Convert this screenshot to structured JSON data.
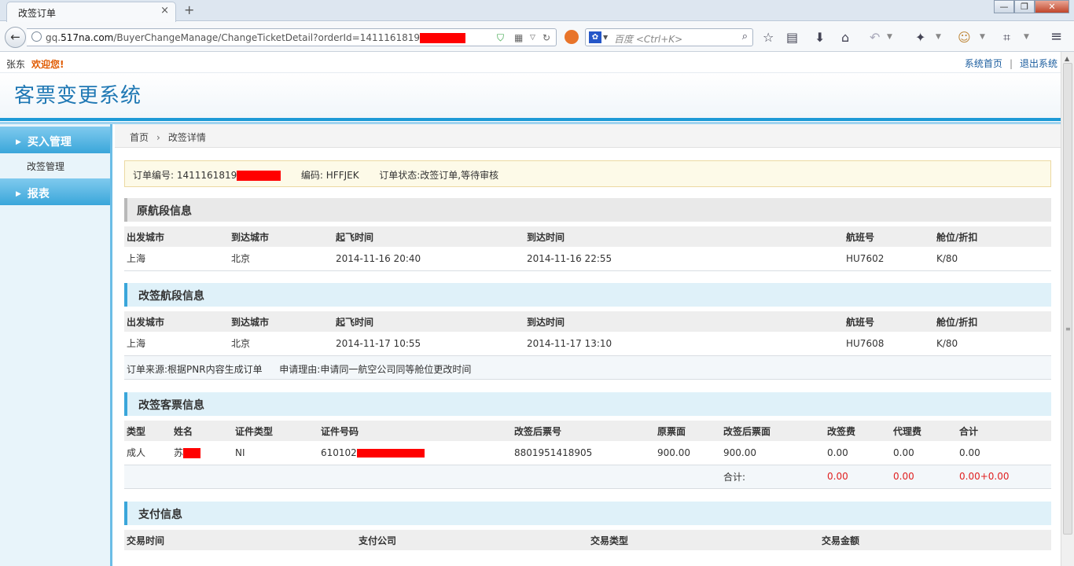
{
  "browser": {
    "tab_title": "改签订单",
    "tab_close": "×",
    "new_tab": "+",
    "url_prefix": "gq.",
    "url_domain": "517na.com",
    "url_path": "/BuyerChangeManage/ChangeTicketDetail?orderId=1411161819",
    "search_placeholder": "百度 <Ctrl+K>",
    "window_buttons": [
      "—",
      "❐",
      "✕"
    ]
  },
  "user": {
    "name": "张东",
    "welcome": "欢迎您!"
  },
  "top_links": [
    "系统首页",
    "退出系统"
  ],
  "system_title": "客票变更系统",
  "sidebar": {
    "groups": [
      {
        "label": "买入管理",
        "items": [
          "改签管理"
        ]
      },
      {
        "label": "报表",
        "items": []
      }
    ]
  },
  "breadcrumb": [
    "首页",
    "改签详情"
  ],
  "order": {
    "number_label": "订单编号:",
    "number": "1411161819",
    "code_label": "编码:",
    "code": "HFFJEK",
    "status_label": "订单状态:",
    "status": "改签订单,等待审核"
  },
  "flight_headers": [
    "出发城市",
    "到达城市",
    "起飞时间",
    "到达时间",
    "航班号",
    "舱位/折扣"
  ],
  "original_segment": {
    "title": "原航段信息",
    "rows": [
      [
        "上海",
        "北京",
        "2014-11-16 20:40",
        "2014-11-16 22:55",
        "HU7602",
        "K/80"
      ]
    ]
  },
  "changed_segment": {
    "title": "改签航段信息",
    "rows": [
      [
        "上海",
        "北京",
        "2014-11-17 10:55",
        "2014-11-17 13:10",
        "HU7608",
        "K/80"
      ]
    ],
    "source_label": "订单来源:",
    "source": "根据PNR内容生成订单",
    "reason_label": "申请理由:",
    "reason": "申请同一航空公司同等舱位更改时间"
  },
  "passengers": {
    "title": "改签客票信息",
    "headers": [
      "类型",
      "姓名",
      "证件类型",
      "证件号码",
      "改签后票号",
      "原票面",
      "改签后票面",
      "改签费",
      "代理费",
      "合计"
    ],
    "rows": [
      {
        "type": "成人",
        "name": "苏",
        "id_type": "NI",
        "id_number": "610102",
        "ticket_no": "8801951418905",
        "orig_fare": "900.00",
        "new_fare": "900.00",
        "change_fee": "0.00",
        "agent_fee": "0.00",
        "total": "0.00"
      }
    ],
    "total_label": "合计:",
    "total_change_fee": "0.00",
    "total_agent_fee": "0.00",
    "total_sum": "0.00+0.00"
  },
  "payment": {
    "title": "支付信息",
    "headers": [
      "交易时间",
      "支付公司",
      "交易类型",
      "交易金额"
    ]
  }
}
